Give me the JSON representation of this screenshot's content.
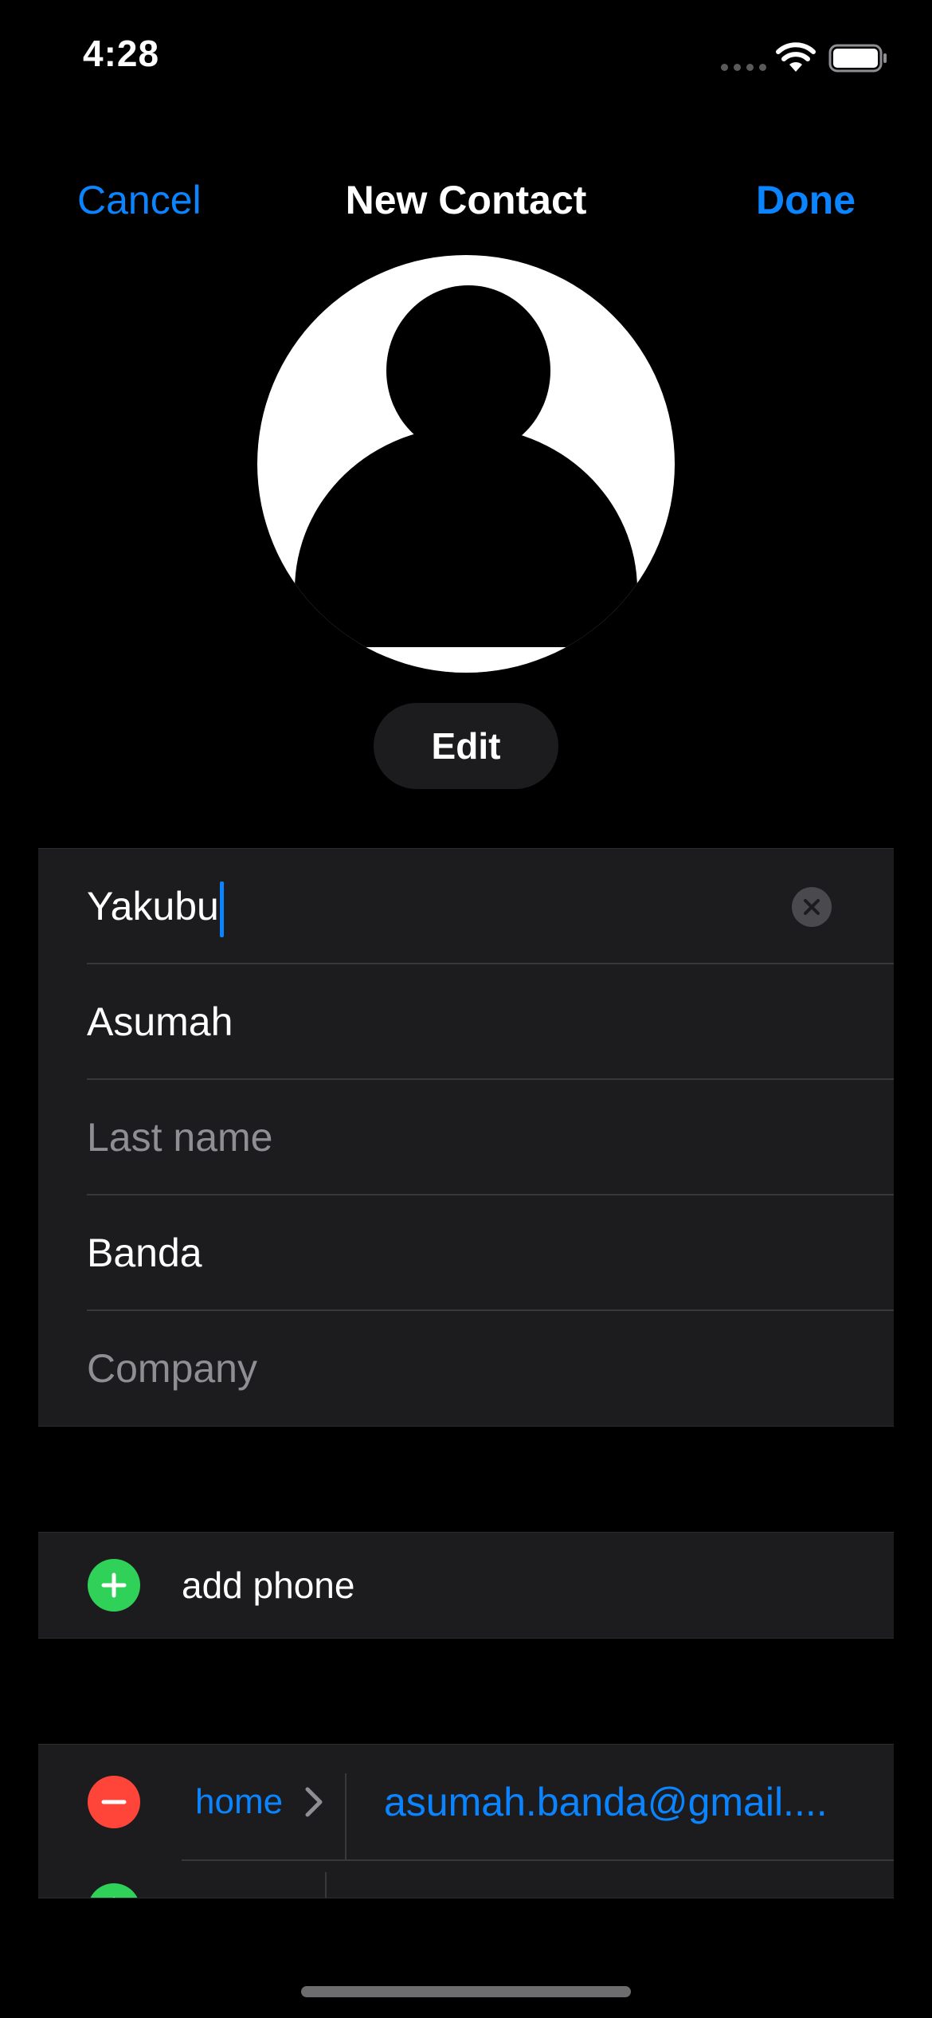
{
  "status_bar": {
    "time": "4:28"
  },
  "nav": {
    "cancel_label": "Cancel",
    "title": "New Contact",
    "done_label": "Done"
  },
  "avatar": {
    "edit_label": "Edit"
  },
  "name_fields": {
    "first_name_value": "Yakubu",
    "middle_name_value": "Asumah",
    "last_name_placeholder": "Last name",
    "last_name_value": "",
    "surname_value": "Banda",
    "company_placeholder": "Company"
  },
  "phone": {
    "add_label": "add phone"
  },
  "email": {
    "label": "home",
    "value": "asumah.banda@gmail...."
  },
  "colors": {
    "accent": "#0a84ff",
    "add": "#30d158",
    "remove": "#ff453a",
    "cell_background": "#1c1c1e",
    "background": "#000000"
  }
}
